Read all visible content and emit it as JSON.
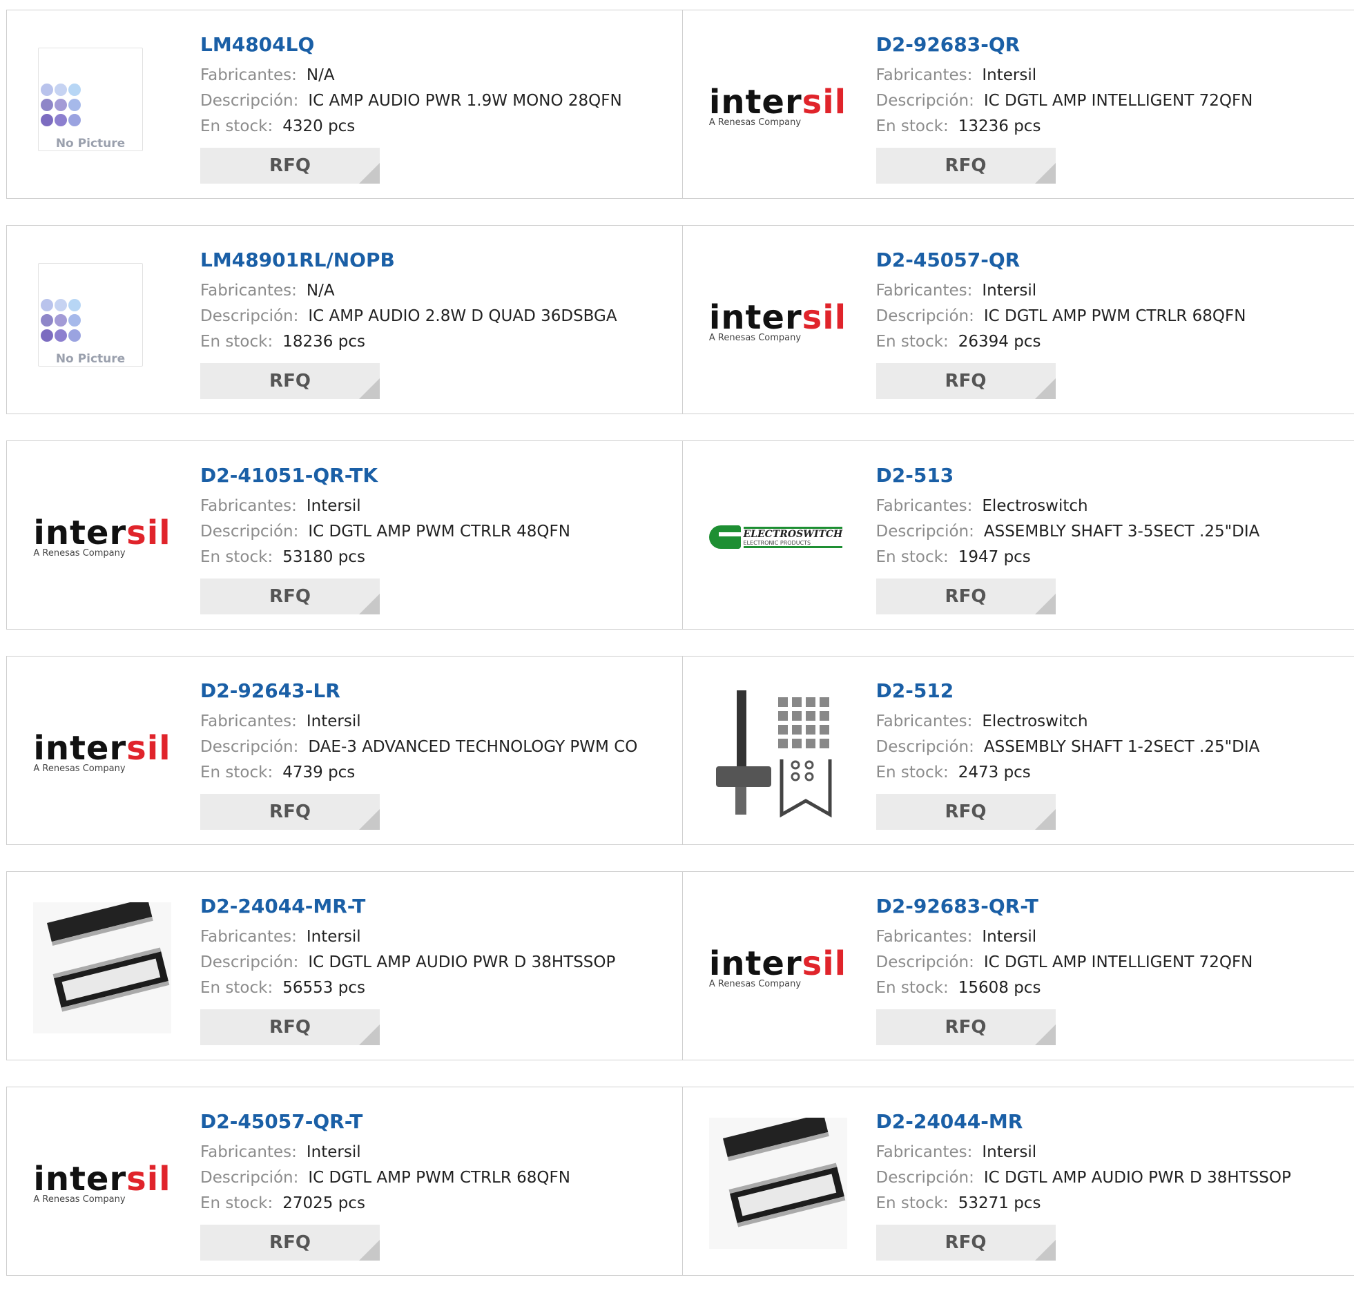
{
  "labels": {
    "manufacturer": "Fabricantes:",
    "description": "Descripción:",
    "stock": "En stock:",
    "rfq": "RFQ",
    "no_picture": "No Picture",
    "intersil_word_a": "inter",
    "intersil_word_b": "sil",
    "intersil_sub": "A Renesas Company",
    "electroswitch_a": "ELECTROSWITCH",
    "electroswitch_b": "ELECTRONIC PRODUCTS"
  },
  "colors": {
    "part_link": "#1a5fa6",
    "label_gray": "#8c8c8c",
    "rfq_bg": "#ebebeb"
  },
  "products": [
    {
      "part": "LM4804LQ",
      "manufacturer": "N/A",
      "description": "IC AMP AUDIO PWR 1.9W MONO 28QFN",
      "stock": "4320 pcs",
      "image": "no-picture"
    },
    {
      "part": "D2-92683-QR",
      "manufacturer": "Intersil",
      "description": "IC DGTL AMP INTELLIGENT 72QFN",
      "stock": "13236 pcs",
      "image": "intersil-logo"
    },
    {
      "part": "LM48901RL/NOPB",
      "manufacturer": "N/A",
      "description": "IC AMP AUDIO 2.8W D QUAD 36DSBGA",
      "stock": "18236 pcs",
      "image": "no-picture"
    },
    {
      "part": "D2-45057-QR",
      "manufacturer": "Intersil",
      "description": "IC DGTL AMP PWM CTRLR 68QFN",
      "stock": "26394 pcs",
      "image": "intersil-logo"
    },
    {
      "part": "D2-41051-QR-TK",
      "manufacturer": "Intersil",
      "description": "IC DGTL AMP PWM CTRLR 48QFN",
      "stock": "53180 pcs",
      "image": "intersil-logo"
    },
    {
      "part": "D2-513",
      "manufacturer": "Electroswitch",
      "description": "ASSEMBLY SHAFT 3-5SECT .25\"DIA",
      "stock": "1947 pcs",
      "image": "electroswitch-logo"
    },
    {
      "part": "D2-92643-LR",
      "manufacturer": "Intersil",
      "description": "DAE-3 ADVANCED TECHNOLOGY PWM CO",
      "stock": "4739 pcs",
      "image": "intersil-logo"
    },
    {
      "part": "D2-512",
      "manufacturer": "Electroswitch",
      "description": "ASSEMBLY SHAFT 1-2SECT .25\"DIA",
      "stock": "2473 pcs",
      "image": "shaft-assembly-photo"
    },
    {
      "part": "D2-24044-MR-T",
      "manufacturer": "Intersil",
      "description": "IC DGTL AMP AUDIO PWR D 38HTSSOP",
      "stock": "56553 pcs",
      "image": "chip-photo"
    },
    {
      "part": "D2-92683-QR-T",
      "manufacturer": "Intersil",
      "description": "IC DGTL AMP INTELLIGENT 72QFN",
      "stock": "15608 pcs",
      "image": "intersil-logo"
    },
    {
      "part": "D2-45057-QR-T",
      "manufacturer": "Intersil",
      "description": "IC DGTL AMP PWM CTRLR 68QFN",
      "stock": "27025 pcs",
      "image": "intersil-logo"
    },
    {
      "part": "D2-24044-MR",
      "manufacturer": "Intersil",
      "description": "IC DGTL AMP AUDIO PWR D 38HTSSOP",
      "stock": "53271 pcs",
      "image": "chip-photo"
    }
  ]
}
